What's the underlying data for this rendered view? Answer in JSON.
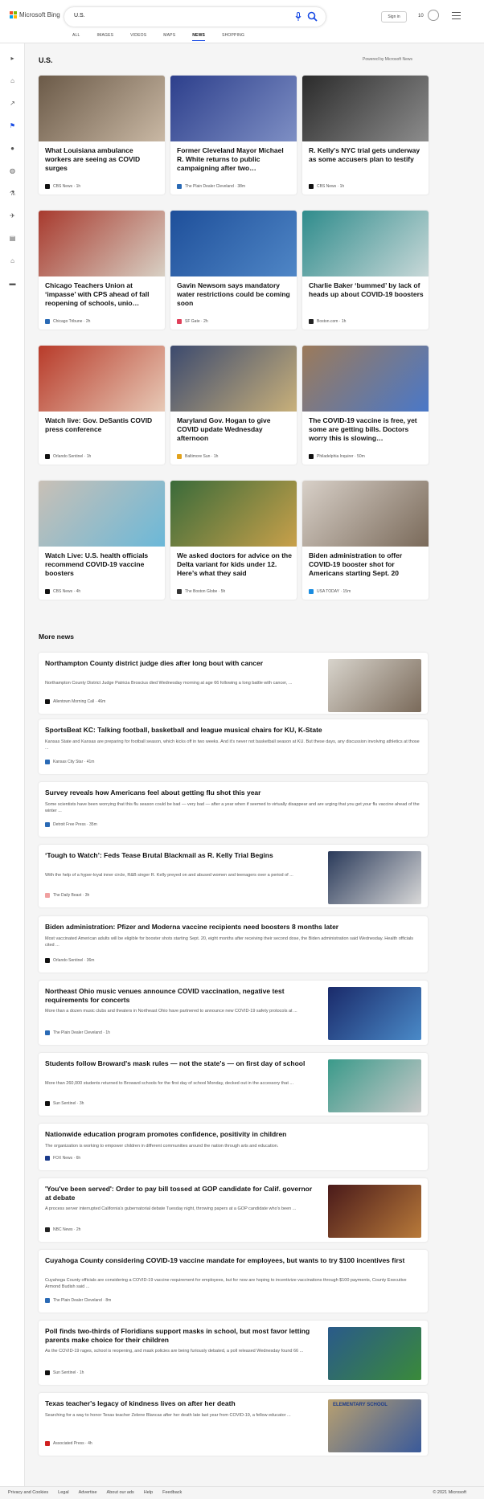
{
  "header": {
    "logo_text": "Microsoft Bing",
    "search_query": "U.S.",
    "signin_label": "Sign in",
    "rewards_count": "10",
    "tabs": [
      {
        "label": "ALL"
      },
      {
        "label": "IMAGES"
      },
      {
        "label": "VIDEOS"
      },
      {
        "label": "MAPS"
      },
      {
        "label": "NEWS"
      },
      {
        "label": "SHOPPING"
      }
    ],
    "active_tab": "NEWS"
  },
  "section": {
    "title": "U.S.",
    "powered_by": "Powered by Microsoft News"
  },
  "cards": [
    {
      "title": "What Louisiana ambulance workers are seeing as COVID surges",
      "source": "CBS News",
      "time": "1h",
      "logo_color": "#111111",
      "img_colors": [
        "#6b5a48",
        "#c9b8a4"
      ]
    },
    {
      "title": "Former Cleveland Mayor Michael R. White returns to public campaigning after two…",
      "source": "The Plain Dealer Cleveland",
      "time": "38m",
      "logo_color": "#2a6ab5",
      "img_colors": [
        "#2d3f8c",
        "#7e8fc4"
      ]
    },
    {
      "title": "R. Kelly's NYC trial gets underway as some accusers plan to testify",
      "source": "CBS News",
      "time": "1h",
      "logo_color": "#111111",
      "img_colors": [
        "#2b2b2b",
        "#8c8c8c"
      ]
    },
    {
      "title": "Chicago Teachers Union at ‘impasse’ with CPS ahead of fall reopening of schools, unio…",
      "source": "Chicago Tribune",
      "time": "2h",
      "logo_color": "#2a6ab5",
      "img_colors": [
        "#a83a2e",
        "#d8d0c4"
      ]
    },
    {
      "title": "Gavin Newsom says mandatory water restrictions could be coming soon",
      "source": "SF Gate",
      "time": "2h",
      "logo_color": "#e0405a",
      "img_colors": [
        "#1e4f9a",
        "#4f86c6"
      ]
    },
    {
      "title": "Charlie Baker ‘bummed’ by lack of heads up about COVID-19 boosters",
      "source": "Boston.com",
      "time": "1h",
      "logo_color": "#222222",
      "img_colors": [
        "#2f8c8c",
        "#c8d8d8"
      ]
    },
    {
      "title": "Watch live: Gov. DeSantis COVID press conference",
      "source": "Orlando Sentinel",
      "time": "1h",
      "logo_color": "#111111",
      "img_colors": [
        "#b83b2a",
        "#e7c9b6"
      ]
    },
    {
      "title": "Maryland Gov. Hogan to give COVID update Wednesday afternoon",
      "source": "Baltimore Sun",
      "time": "1h",
      "logo_color": "#e2a21c",
      "img_colors": [
        "#3c4a6e",
        "#c8b07a"
      ]
    },
    {
      "title": "The COVID-19 vaccine is free, yet some are getting bills. Doctors worry this is slowing…",
      "source": "Philadelphia Inquirer",
      "time": "50m",
      "logo_color": "#111111",
      "img_colors": [
        "#9c7a5a",
        "#4a78c8"
      ]
    },
    {
      "title": "Watch Live: U.S. health officials recommend COVID-19 vaccine boosters",
      "source": "CBS News",
      "time": "4h",
      "logo_color": "#111111",
      "img_colors": [
        "#c9c0b6",
        "#6bb8d8"
      ]
    },
    {
      "title": "We asked doctors for advice on the Delta variant for kids under 12. Here’s what they said",
      "source": "The Boston Globe",
      "time": "5h",
      "logo_color": "#333333",
      "img_colors": [
        "#3a6b3a",
        "#c8a04a"
      ]
    },
    {
      "title": "Biden administration to offer COVID-19 booster shot for Americans starting Sept. 20",
      "source": "USA TODAY",
      "time": "15m",
      "logo_color": "#1a8ce0",
      "img_colors": [
        "#d8d0c8",
        "#7a6a5a"
      ]
    }
  ],
  "more_news": {
    "title": "More news",
    "items": [
      {
        "title": "Northampton County district judge dies after long bout with cancer",
        "snippet": "Northampton County District Judge Patricia Broscius died Wednesday morning at age 66 following a long battle with cancer, ...",
        "source": "Allentown Morning Call",
        "time": "46m",
        "logo_color": "#111111",
        "img_colors": [
          "#d8d4cc",
          "#7a6a5a"
        ]
      },
      {
        "title": "SportsBeat KC: Talking football, basketball and league musical chairs for KU, K-State",
        "snippet": "Kansas State and Kansas are preparing for football season, which kicks off in two weeks. And it’s never not basketball season at KU. But these days, any discussion involving athletics at those ...",
        "source": "Kansas City Star",
        "time": "41m",
        "logo_color": "#2a6ab5",
        "img_colors": null
      },
      {
        "title": "Survey reveals how Americans feel about getting flu shot this year",
        "snippet": "Some scientists have been worrying that this flu season could be bad — very bad — after a year when if seemed to virtually disappear and are urging that you get your flu vaccine ahead of the winter ...",
        "source": "Detroit Free Press",
        "time": "35m",
        "logo_color": "#2a6ab5",
        "img_colors": null
      },
      {
        "title": "‘Tough to Watch’: Feds Tease Brutal Blackmail as R. Kelly Trial Begins",
        "snippet": "With the help of a hyper-loyal inner circle, R&B singer R. Kelly preyed on and abused women and teenagers over a period of ...",
        "source": "The Daily Beast",
        "time": "3h",
        "logo_color": "#f0a0a0",
        "img_colors": [
          "#2a3a5a",
          "#d8d8d8"
        ]
      },
      {
        "title": "Biden administration: Pfizer and Moderna vaccine recipients need boosters 8 months later",
        "snippet": "Most vaccinated American adults will be eligible for booster shots starting Sept. 20, eight months after receiving their second dose, the Biden administration said Wednesday. Health officials cited ...",
        "source": "Orlando Sentinel",
        "time": "36m",
        "logo_color": "#111111",
        "img_colors": null
      },
      {
        "title": "Northeast Ohio music venues announce COVID vaccination, negative test requirements for concerts",
        "snippet": "More than a dozen music clubs and theaters in Northeast Ohio have partnered to announce new COVID-19 safety protocols at ...",
        "source": "The Plain Dealer Cleveland",
        "time": "1h",
        "logo_color": "#2a6ab5",
        "img_colors": [
          "#1a2a6a",
          "#4a8ac8"
        ]
      },
      {
        "title": "Students follow Broward's mask rules — not the state's — on first day of school",
        "snippet": "More than 260,000 students returned to Broward schools for the first day of school Monday, decked out in the accessory that ...",
        "source": "Sun Sentinel",
        "time": "3h",
        "logo_color": "#111111",
        "img_colors": [
          "#3a9a8a",
          "#c8c8c8"
        ]
      },
      {
        "title": "Nationwide education program promotes confidence, positivity in children",
        "snippet": "The organization is working to empower children in different communities around the nation through arts and education.",
        "source": "FOX News",
        "time": "6h",
        "logo_color": "#1a3a8a",
        "img_colors": null
      },
      {
        "title": "'You've been served': Order to pay bill tossed at GOP candidate for Calif. governor at debate",
        "snippet": "A process server interrupted California's gubernatorial debate Tuesday night, throwing papers at a GOP candidate who's been ...",
        "source": "NBC News",
        "time": "2h",
        "logo_color": "#222222",
        "img_colors": [
          "#4a1a1a",
          "#b87a3a"
        ]
      },
      {
        "title": "Cuyahoga County considering COVID-19 vaccine mandate for employees, but wants to try $100 incentives first",
        "snippet": "Cuyahoga County officials are considering a COVID-19 vaccine requirement for employees, but for now are hoping to incentivize vaccinations through $100 payments, County Executive Armond Budish said ...",
        "source": "The Plain Dealer Cleveland",
        "time": "8m",
        "logo_color": "#2a6ab5",
        "img_colors": null
      },
      {
        "title": "Poll finds two-thirds of Floridians support masks in school, but most favor letting parents make choice for their children",
        "snippet": "As the COVID-19 rages, school is reopening, and mask policies are being furiously debated, a poll released Wednesday found 66 ...",
        "source": "Sun Sentinel",
        "time": "1h",
        "logo_color": "#111111",
        "img_colors": [
          "#2a5a8a",
          "#3a8a3a"
        ]
      },
      {
        "title": "Texas teacher's legacy of kindness lives on after her death",
        "snippet": "Searching for a way to honor Texas teacher Zelene Blancas after her death late last year from COVID-19, a fellow educator ...",
        "source": "Associated Press",
        "time": "4h",
        "logo_color": "#d02020",
        "img_colors": [
          "#b8a070",
          "#3a5a9a"
        ]
      }
    ]
  },
  "thumb_caption": "ELEMENTARY SCHOOL",
  "footer": {
    "links": [
      "Privacy and Cookies",
      "Legal",
      "Advertise",
      "About our ads",
      "Help",
      "Feedback"
    ],
    "copyright": "© 2021 Microsoft"
  },
  "colors": {
    "accent": "#174ae4",
    "logo": [
      "#f25022",
      "#7fba00",
      "#00a4ef",
      "#ffb900"
    ]
  }
}
